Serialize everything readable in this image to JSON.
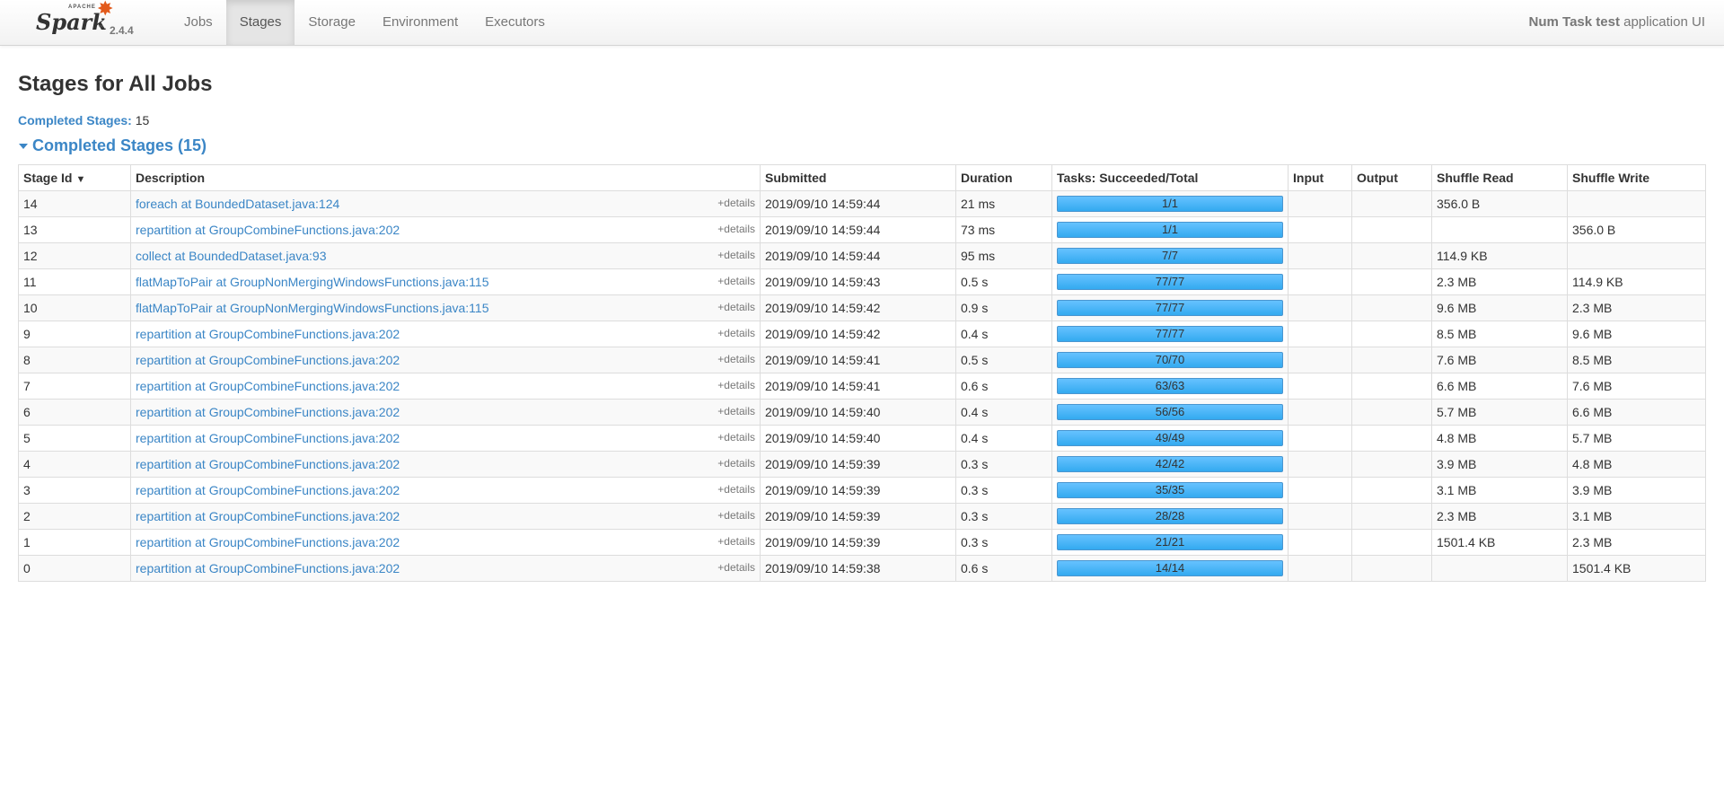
{
  "brand": {
    "apache": "APACHE",
    "spark": "Spark",
    "tm": "™",
    "version": "2.4.4"
  },
  "nav": [
    "Jobs",
    "Stages",
    "Storage",
    "Environment",
    "Executors"
  ],
  "app": {
    "name": "Num Task test",
    "suffix": " application UI"
  },
  "page": {
    "title": "Stages for All Jobs",
    "summary_label": "Completed Stages:",
    "summary_value": "15",
    "section_title": "Completed Stages (15)"
  },
  "table": {
    "headers": [
      "Stage Id",
      "Description",
      "Submitted",
      "Duration",
      "Tasks: Succeeded/Total",
      "Input",
      "Output",
      "Shuffle Read",
      "Shuffle Write"
    ],
    "sort_arrow": "▼",
    "details_label": "+details",
    "rows": [
      {
        "id": "14",
        "desc": "foreach at BoundedDataset.java:124",
        "submitted": "2019/09/10 14:59:44",
        "duration": "21 ms",
        "tasks": "1/1",
        "input": "",
        "output": "",
        "sread": "356.0 B",
        "swrite": ""
      },
      {
        "id": "13",
        "desc": "repartition at GroupCombineFunctions.java:202",
        "submitted": "2019/09/10 14:59:44",
        "duration": "73 ms",
        "tasks": "1/1",
        "input": "",
        "output": "",
        "sread": "",
        "swrite": "356.0 B"
      },
      {
        "id": "12",
        "desc": "collect at BoundedDataset.java:93",
        "submitted": "2019/09/10 14:59:44",
        "duration": "95 ms",
        "tasks": "7/7",
        "input": "",
        "output": "",
        "sread": "114.9 KB",
        "swrite": ""
      },
      {
        "id": "11",
        "desc": "flatMapToPair at GroupNonMergingWindowsFunctions.java:115",
        "submitted": "2019/09/10 14:59:43",
        "duration": "0.5 s",
        "tasks": "77/77",
        "input": "",
        "output": "",
        "sread": "2.3 MB",
        "swrite": "114.9 KB"
      },
      {
        "id": "10",
        "desc": "flatMapToPair at GroupNonMergingWindowsFunctions.java:115",
        "submitted": "2019/09/10 14:59:42",
        "duration": "0.9 s",
        "tasks": "77/77",
        "input": "",
        "output": "",
        "sread": "9.6 MB",
        "swrite": "2.3 MB"
      },
      {
        "id": "9",
        "desc": "repartition at GroupCombineFunctions.java:202",
        "submitted": "2019/09/10 14:59:42",
        "duration": "0.4 s",
        "tasks": "77/77",
        "input": "",
        "output": "",
        "sread": "8.5 MB",
        "swrite": "9.6 MB"
      },
      {
        "id": "8",
        "desc": "repartition at GroupCombineFunctions.java:202",
        "submitted": "2019/09/10 14:59:41",
        "duration": "0.5 s",
        "tasks": "70/70",
        "input": "",
        "output": "",
        "sread": "7.6 MB",
        "swrite": "8.5 MB"
      },
      {
        "id": "7",
        "desc": "repartition at GroupCombineFunctions.java:202",
        "submitted": "2019/09/10 14:59:41",
        "duration": "0.6 s",
        "tasks": "63/63",
        "input": "",
        "output": "",
        "sread": "6.6 MB",
        "swrite": "7.6 MB"
      },
      {
        "id": "6",
        "desc": "repartition at GroupCombineFunctions.java:202",
        "submitted": "2019/09/10 14:59:40",
        "duration": "0.4 s",
        "tasks": "56/56",
        "input": "",
        "output": "",
        "sread": "5.7 MB",
        "swrite": "6.6 MB"
      },
      {
        "id": "5",
        "desc": "repartition at GroupCombineFunctions.java:202",
        "submitted": "2019/09/10 14:59:40",
        "duration": "0.4 s",
        "tasks": "49/49",
        "input": "",
        "output": "",
        "sread": "4.8 MB",
        "swrite": "5.7 MB"
      },
      {
        "id": "4",
        "desc": "repartition at GroupCombineFunctions.java:202",
        "submitted": "2019/09/10 14:59:39",
        "duration": "0.3 s",
        "tasks": "42/42",
        "input": "",
        "output": "",
        "sread": "3.9 MB",
        "swrite": "4.8 MB"
      },
      {
        "id": "3",
        "desc": "repartition at GroupCombineFunctions.java:202",
        "submitted": "2019/09/10 14:59:39",
        "duration": "0.3 s",
        "tasks": "35/35",
        "input": "",
        "output": "",
        "sread": "3.1 MB",
        "swrite": "3.9 MB"
      },
      {
        "id": "2",
        "desc": "repartition at GroupCombineFunctions.java:202",
        "submitted": "2019/09/10 14:59:39",
        "duration": "0.3 s",
        "tasks": "28/28",
        "input": "",
        "output": "",
        "sread": "2.3 MB",
        "swrite": "3.1 MB"
      },
      {
        "id": "1",
        "desc": "repartition at GroupCombineFunctions.java:202",
        "submitted": "2019/09/10 14:59:39",
        "duration": "0.3 s",
        "tasks": "21/21",
        "input": "",
        "output": "",
        "sread": "1501.4 KB",
        "swrite": "2.3 MB"
      },
      {
        "id": "0",
        "desc": "repartition at GroupCombineFunctions.java:202",
        "submitted": "2019/09/10 14:59:38",
        "duration": "0.6 s",
        "tasks": "14/14",
        "input": "",
        "output": "",
        "sread": "",
        "swrite": "1501.4 KB"
      }
    ]
  },
  "colors": {
    "accent": "#3b86c6",
    "bar": "#33aaf0",
    "logo": "#e25a1c"
  }
}
